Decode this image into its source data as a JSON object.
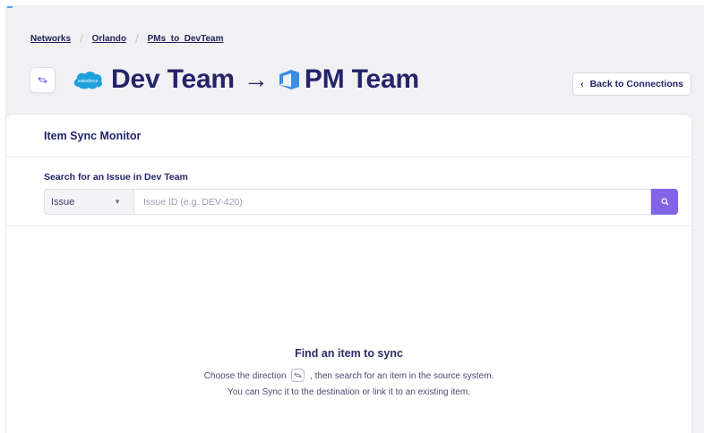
{
  "breadcrumb": {
    "items": [
      "Networks",
      "Orlando",
      "PMs_to_DevTeam"
    ]
  },
  "header": {
    "source_name": "Dev Team",
    "arrow": "→",
    "dest_name": "PM Team",
    "source_logo_text": "salesforce",
    "source_icon": "salesforce-cloud-icon",
    "dest_icon": "azure-devops-icon",
    "swap_icon": "swap-arrows-icon"
  },
  "back_button": {
    "label": "Back to Connections",
    "icon": "chevron-left-icon"
  },
  "card": {
    "title": "Item Sync Monitor",
    "search_label": "Search for an Issue in Dev Team",
    "type_select": {
      "value": "Issue"
    },
    "search_input": {
      "value": "",
      "placeholder": "Issue ID (e.g. DEV-420)"
    },
    "search_icon": "search-icon"
  },
  "empty_state": {
    "title": "Find an item to sync",
    "line1_before": "Choose the direction",
    "line1_after": ", then search for an item in the source system.",
    "line2": "You can Sync it to the destination or link it to an existing item."
  },
  "colors": {
    "accent": "#8363e6",
    "title": "#25246a",
    "salesforce": "#1ea0dc",
    "azure": "#3a8ee6"
  }
}
